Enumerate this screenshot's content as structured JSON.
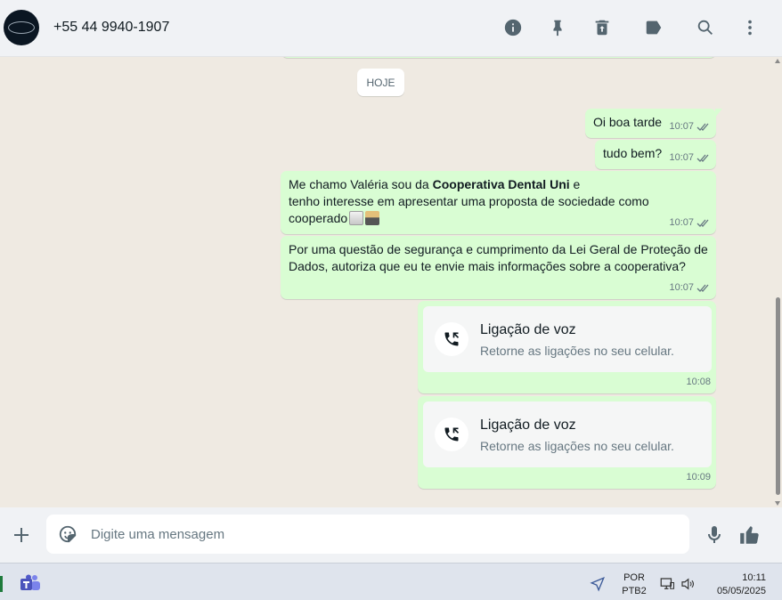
{
  "header": {
    "contact_name": "+55 44 9940-1907",
    "icons": [
      "info-icon",
      "pin-icon",
      "delete-icon",
      "label-icon",
      "search-icon",
      "menu-icon"
    ]
  },
  "chat": {
    "date_divider": "HOJE",
    "messages": [
      {
        "text": "Oi boa tarde",
        "time": "10:07",
        "status": "read"
      },
      {
        "text": "tudo bem?",
        "time": "10:07",
        "status": "read"
      },
      {
        "line1_prefix": "Me chamo Valéria sou da ",
        "line1_bold": "Cooperativa Dental Uni",
        "line1_suffix": " e",
        "line2": "tenho interesse em apresentar uma proposta de sociedade como",
        "line3": "cooperado",
        "time": "10:07",
        "status": "read"
      },
      {
        "line1": "Por uma questão de segurança e cumprimento da Lei Geral de Proteção de",
        "line2": "Dados, autoriza que eu te envie mais informações sobre a cooperativa?",
        "time": "10:07",
        "status": "read"
      }
    ],
    "calls": [
      {
        "title": "Ligação de voz",
        "subtitle": "Retorne as ligações no seu celular.",
        "time": "10:08"
      },
      {
        "title": "Ligação de voz",
        "subtitle": "Retorne as ligações no seu celular.",
        "time": "10:09"
      }
    ]
  },
  "composer": {
    "placeholder": "Digite uma mensagem"
  },
  "taskbar": {
    "lang_line1": "POR",
    "lang_line2": "PTB2",
    "time": "10:11",
    "date": "05/05/2025"
  },
  "colors": {
    "outgoing_bubble": "#d9fdd3",
    "chat_background": "#efeae2",
    "read_ticks": "#667781"
  }
}
